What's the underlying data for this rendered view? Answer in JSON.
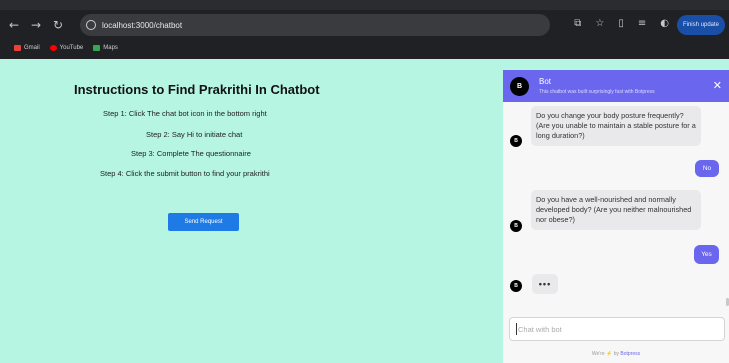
{
  "browser": {
    "url": "localhost:3000/chatbot",
    "finish_update": "Finish update",
    "bookmarks": [
      {
        "label": "Gmail",
        "color": "#ea4335"
      },
      {
        "label": "YouTube",
        "color": "#ff0000"
      },
      {
        "label": "Maps",
        "color": "#34a853"
      }
    ]
  },
  "page": {
    "title": "Instructions to Find Prakrithi In Chatbot",
    "steps": [
      "Step 1: Click The chat bot icon in the bottom right",
      "Step 2: Say Hi to initiate chat",
      "Step 3: Complete The questionnaire",
      "Step 4: Click the submit button to find your prakrithi"
    ],
    "send_button": "Send Request"
  },
  "chat": {
    "header": {
      "avatar": "B",
      "name": "Bot",
      "subtitle": "This chatbot was built surprisingly fast with Botpress",
      "close": "✕"
    },
    "messages": [
      {
        "from": "bot",
        "avatar": "B",
        "text": "Do you change your body posture frequently? (Are you unable to maintain a stable posture for a long duration?)"
      },
      {
        "from": "user",
        "text": "No"
      },
      {
        "from": "bot",
        "avatar": "B",
        "text": "Do you have a well-nourished and normally developed body? (Are you neither malnourished nor obese?)"
      },
      {
        "from": "user",
        "text": "Yes"
      }
    ],
    "typing": "•••",
    "typing_avatar": "B",
    "input_placeholder": "Chat with bot",
    "footer_prefix": "We're ",
    "footer_bolt": "⚡",
    "footer_mid": " by ",
    "footer_brand": "Botpress"
  },
  "colors": {
    "page_bg": "#b5f5e2",
    "accent": "#6b66ee",
    "send_button": "#1e7be6"
  }
}
